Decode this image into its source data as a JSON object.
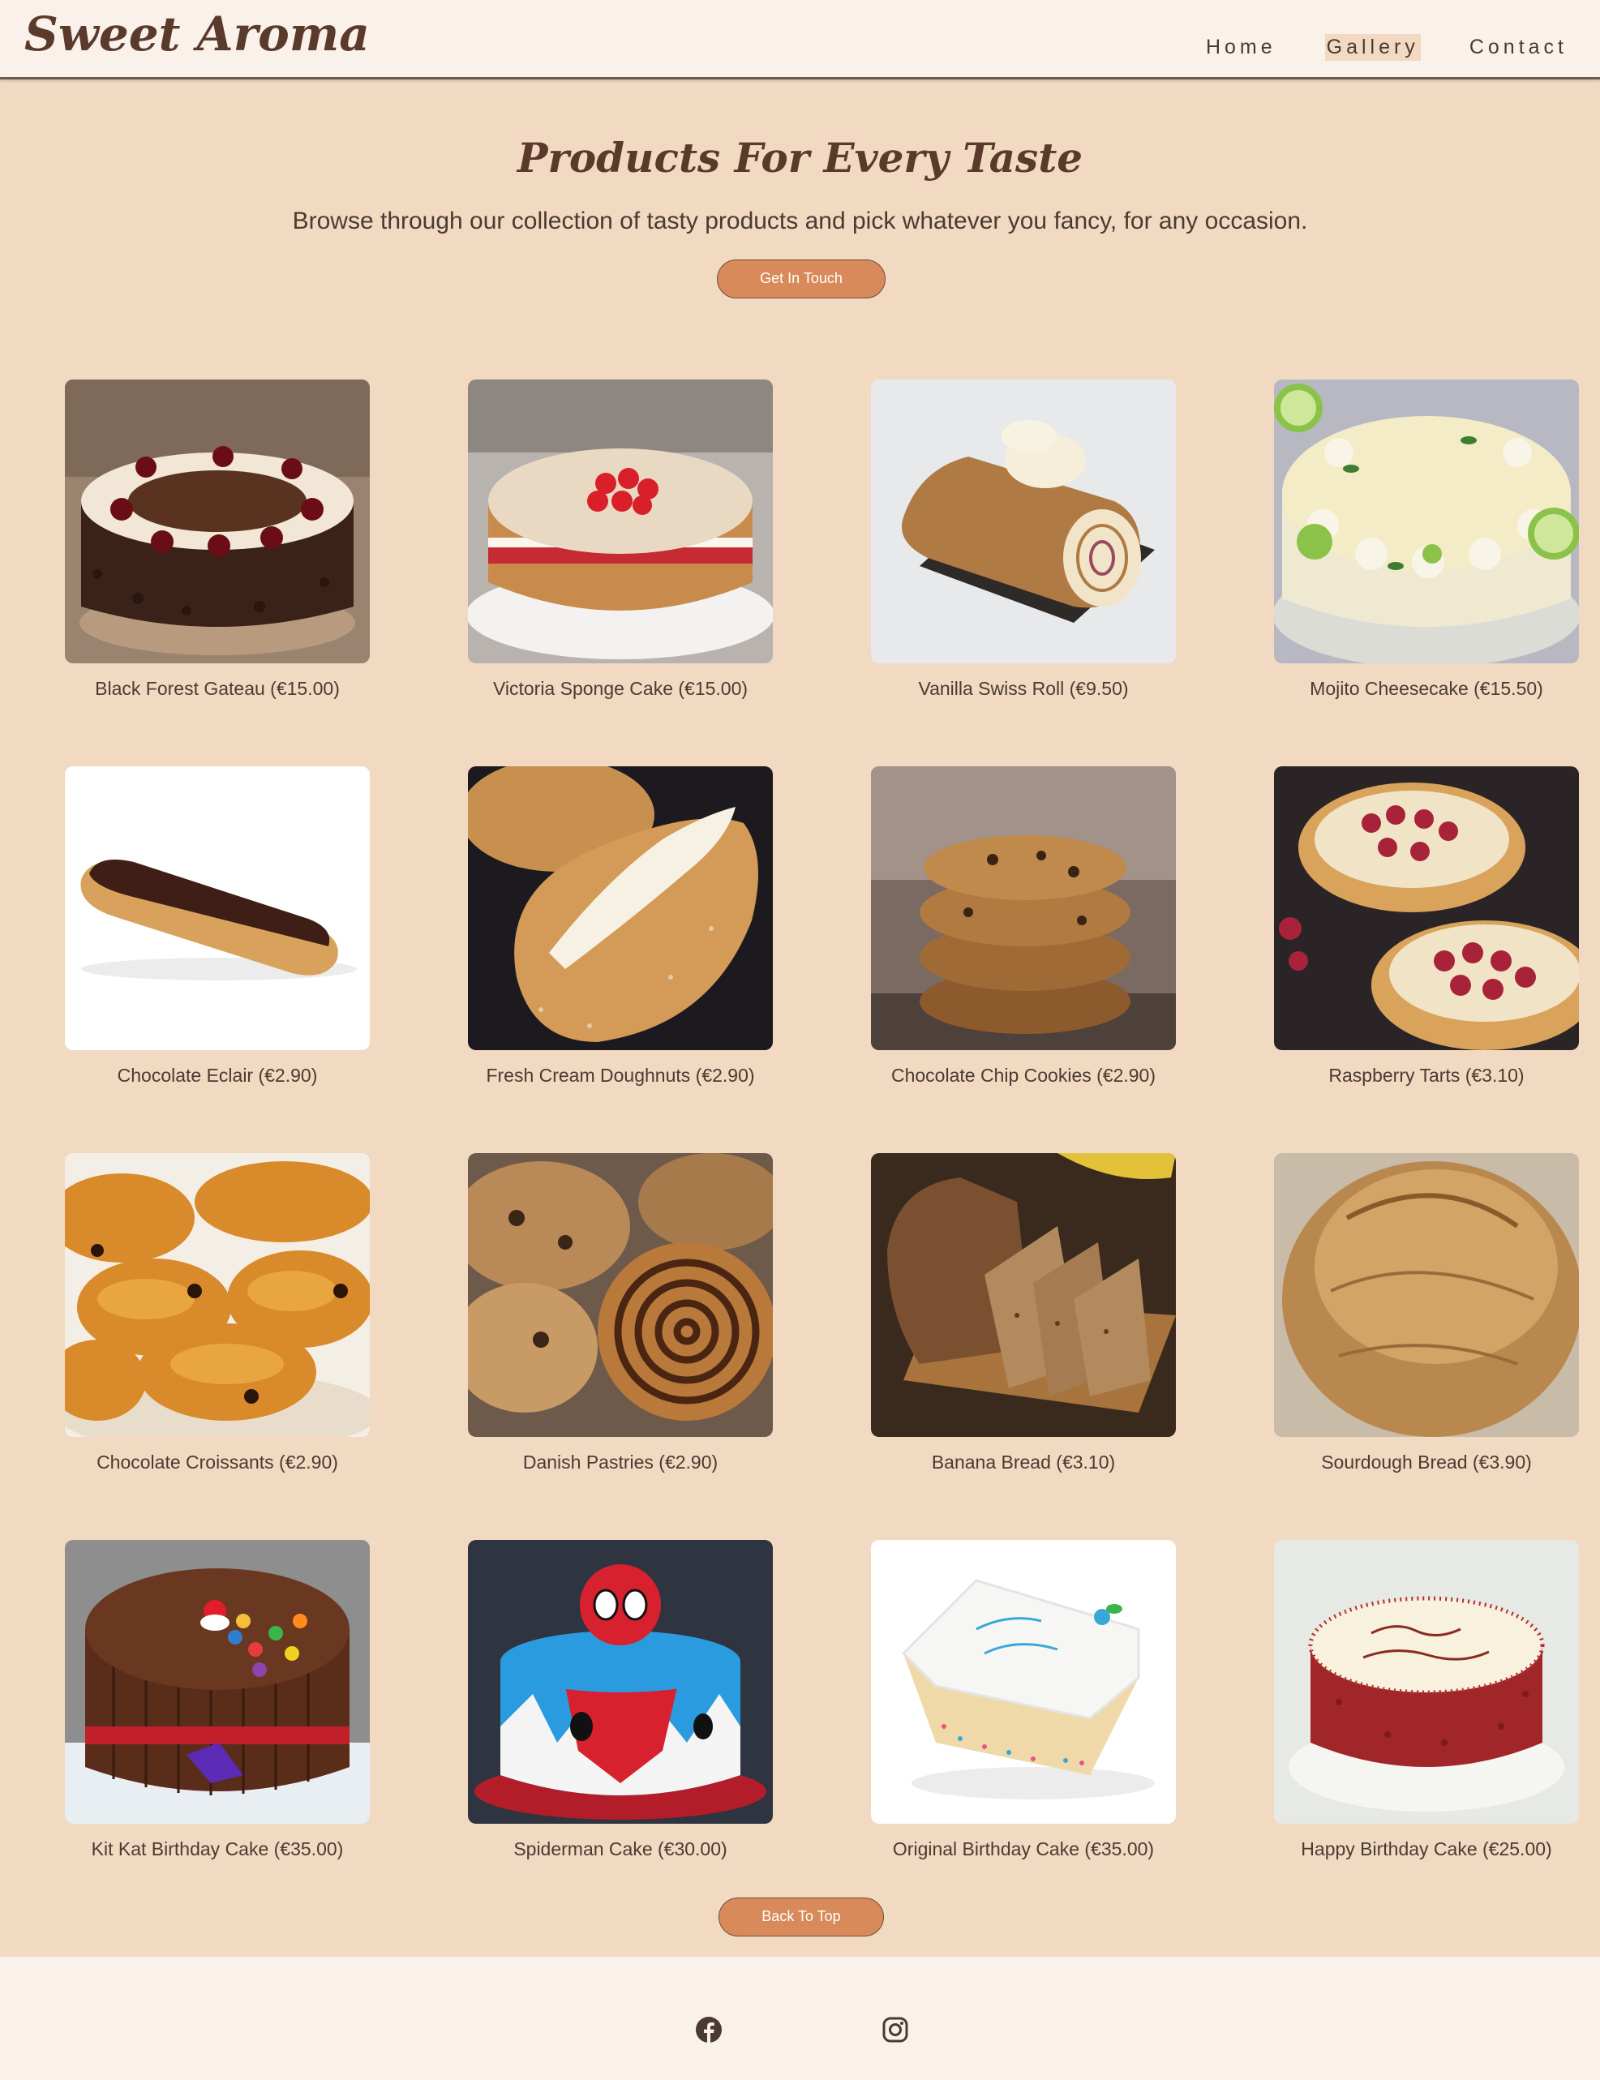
{
  "header": {
    "logo": "Sweet Aroma",
    "nav": [
      {
        "label": "Home",
        "active": false
      },
      {
        "label": "Gallery",
        "active": true
      },
      {
        "label": "Contact",
        "active": false
      }
    ]
  },
  "hero": {
    "title": "Products For Every Taste",
    "subtitle": "Browse through our collection of tasty products and pick whatever you fancy, for any occasion.",
    "cta": "Get In Touch"
  },
  "gallery": [
    {
      "caption": "Black Forest Gateau (€15.00)",
      "image": "black-forest-gateau-photo"
    },
    {
      "caption": "Victoria Sponge Cake (€15.00)",
      "image": "victoria-sponge-cake-photo"
    },
    {
      "caption": "Vanilla Swiss Roll (€9.50)",
      "image": "vanilla-swiss-roll-photo"
    },
    {
      "caption": "Mojito Cheesecake (€15.50)",
      "image": "mojito-cheesecake-photo"
    },
    {
      "caption": "Chocolate Eclair (€2.90)",
      "image": "chocolate-eclair-photo"
    },
    {
      "caption": "Fresh Cream Doughnuts (€2.90)",
      "image": "fresh-cream-doughnuts-photo"
    },
    {
      "caption": "Chocolate Chip Cookies (€2.90)",
      "image": "chocolate-chip-cookies-photo"
    },
    {
      "caption": "Raspberry Tarts (€3.10)",
      "image": "raspberry-tarts-photo"
    },
    {
      "caption": "Chocolate Croissants (€2.90)",
      "image": "chocolate-croissants-photo"
    },
    {
      "caption": "Danish Pastries (€2.90)",
      "image": "danish-pastries-photo"
    },
    {
      "caption": "Banana Bread (€3.10)",
      "image": "banana-bread-photo"
    },
    {
      "caption": "Sourdough Bread (€3.90)",
      "image": "sourdough-bread-photo"
    },
    {
      "caption": "Kit Kat Birthday Cake (€35.00)",
      "image": "kit-kat-birthday-cake-photo"
    },
    {
      "caption": "Spiderman Cake (€30.00)",
      "image": "spiderman-cake-photo"
    },
    {
      "caption": "Original Birthday Cake (€35.00)",
      "image": "original-birthday-cake-photo"
    },
    {
      "caption": "Happy Birthday Cake (€25.00)",
      "image": "happy-birthday-cake-photo"
    }
  ],
  "back_to_top": "Back To Top",
  "footer": {
    "social": [
      "facebook-icon",
      "instagram-icon"
    ]
  },
  "colors": {
    "page_bg": "#f2d9c1",
    "header_bg": "#faf1ea",
    "brand_brown": "#5a3a2b",
    "button": "#d88a5a"
  }
}
